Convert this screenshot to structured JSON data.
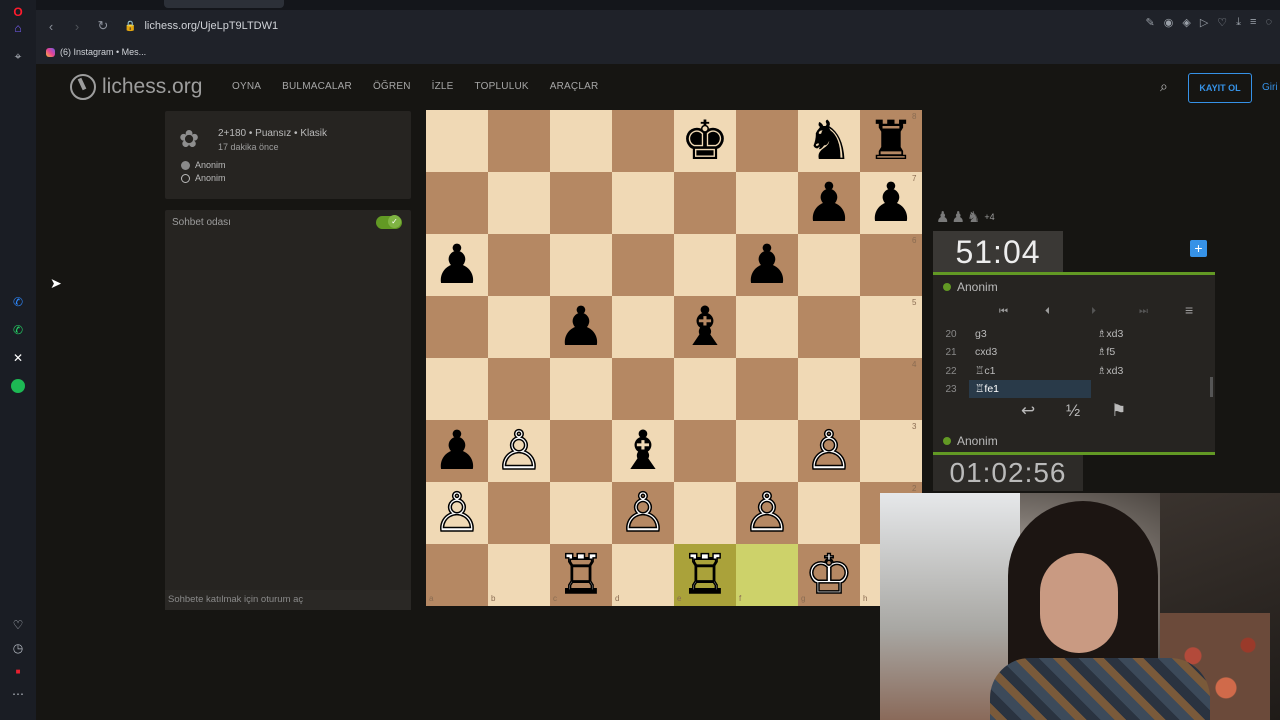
{
  "browser": {
    "url": "lichess.org/UjeLpT9LTDW1",
    "bookmark_label": "(6) Instagram • Mes..."
  },
  "site": {
    "logo_text": "lichess.org",
    "nav": [
      "OYNA",
      "BULMACALAR",
      "ÖĞREN",
      "İZLE",
      "TOPLULUK",
      "ARAÇLAR"
    ],
    "signup_label": "KAYIT OL",
    "signin_label": "Giri"
  },
  "game_info": {
    "type": "2+180 • Puansız • Klasik",
    "ago": "17 dakika önce",
    "players": [
      "Anonim",
      "Anonim"
    ]
  },
  "chat": {
    "title": "Sohbet odası",
    "placeholder": "Sohbete katılmak için oturum aç",
    "enabled": true
  },
  "board": {
    "files": [
      "a",
      "b",
      "c",
      "d",
      "e",
      "f",
      "g",
      "h"
    ],
    "ranks": [
      "8",
      "7",
      "6",
      "5",
      "4",
      "3",
      "2",
      "1"
    ],
    "highlight": [
      "e1",
      "f1"
    ],
    "pieces": [
      {
        "sq": "e8",
        "p": "♚",
        "c": "b"
      },
      {
        "sq": "g8",
        "p": "♞",
        "c": "b"
      },
      {
        "sq": "h8",
        "p": "♜",
        "c": "b"
      },
      {
        "sq": "g7",
        "p": "♟",
        "c": "b"
      },
      {
        "sq": "h7",
        "p": "♟",
        "c": "b"
      },
      {
        "sq": "a6",
        "p": "♟",
        "c": "b"
      },
      {
        "sq": "f6",
        "p": "♟",
        "c": "b"
      },
      {
        "sq": "c5",
        "p": "♟",
        "c": "b"
      },
      {
        "sq": "e5",
        "p": "♝",
        "c": "b"
      },
      {
        "sq": "a3",
        "p": "♟",
        "c": "b"
      },
      {
        "sq": "b3",
        "p": "♙",
        "c": "w"
      },
      {
        "sq": "d3",
        "p": "♝",
        "c": "b"
      },
      {
        "sq": "g3",
        "p": "♙",
        "c": "w"
      },
      {
        "sq": "a2",
        "p": "♙",
        "c": "w"
      },
      {
        "sq": "d2",
        "p": "♙",
        "c": "w"
      },
      {
        "sq": "f2",
        "p": "♙",
        "c": "w"
      },
      {
        "sq": "c1",
        "p": "♖",
        "c": "w"
      },
      {
        "sq": "e1",
        "p": "♖",
        "c": "w"
      },
      {
        "sq": "g1",
        "p": "♔",
        "c": "w"
      }
    ]
  },
  "material": {
    "pieces": [
      "♟",
      "♟",
      "♞"
    ],
    "diff": "+4"
  },
  "clocks": {
    "top": "51:04",
    "bottom": "01:02:56"
  },
  "players": {
    "top": "Anonim",
    "bottom": "Anonim"
  },
  "moves": [
    {
      "n": "20",
      "w": "g3",
      "b": "♗xd3"
    },
    {
      "n": "21",
      "w": "cxd3",
      "b": "♗f5"
    },
    {
      "n": "22",
      "w": "♖c1",
      "b": "♗xd3"
    },
    {
      "n": "23",
      "w": "♖fe1",
      "b": ""
    }
  ],
  "actions": {
    "takeback": "↩",
    "draw": "½",
    "resign": "⚑"
  },
  "controls": {
    "first": "⏮",
    "prev": "⏴",
    "next": "⏵",
    "last": "⏭",
    "menu": "≡"
  },
  "colors": {
    "accent": "#3692e7",
    "online": "#629924",
    "board_light": "#f0d9b5",
    "board_dark": "#b58863"
  }
}
